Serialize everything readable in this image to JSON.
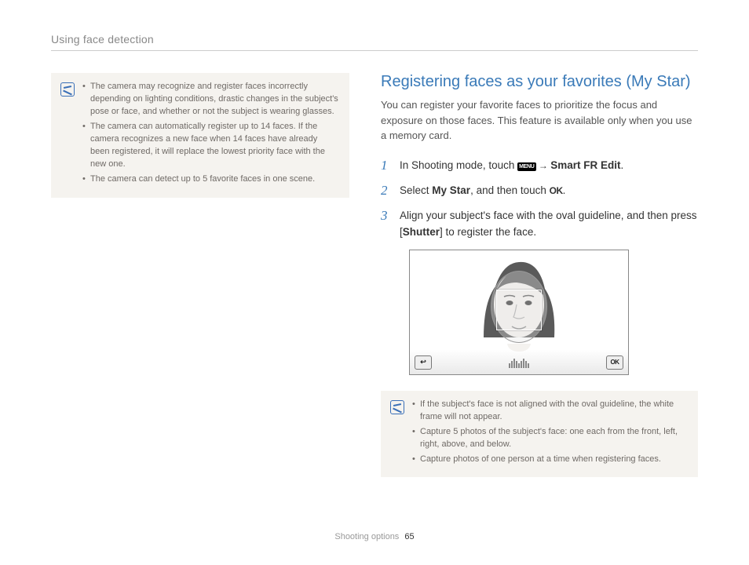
{
  "header": {
    "breadcrumb": "Using face detection"
  },
  "left_note": {
    "items": [
      "The camera may recognize and register faces incorrectly depending on lighting conditions, drastic changes in the subject's pose or face, and whether or not the subject is wearing glasses.",
      "The camera can automatically register up to 14 faces. If the camera recognizes a new face when 14 faces have already been registered, it will replace the lowest priority face with the new one.",
      "The camera can detect up to 5 favorite faces in one scene."
    ]
  },
  "section": {
    "title": "Registering faces as your favorites (My Star)",
    "intro": "You can register your favorite faces to prioritize the focus and exposure on those faces. This feature is available only when you use a memory card."
  },
  "steps": {
    "s1_pre": "In Shooting mode, touch ",
    "menu_label": "MENU",
    "s1_arrow": " → ",
    "s1_bold": "Smart FR Edit",
    "s1_end": ".",
    "s2_pre": "Select ",
    "s2_bold": "My Star",
    "s2_mid": ", and then touch ",
    "ok_label": "OK",
    "s2_end": ".",
    "s3_pre": "Align your subject's face with the oval guideline, and then press [",
    "s3_bold": "Shutter",
    "s3_end": "] to register the face."
  },
  "figure": {
    "back": "↩",
    "ok": "OK"
  },
  "right_note": {
    "items": [
      "If the subject's face is not aligned with the oval guideline, the white frame will not appear.",
      "Capture 5 photos of the subject's face: one each from the front, left, right, above, and below.",
      "Capture photos of one person at a time when registering faces."
    ]
  },
  "footer": {
    "section": "Shooting options",
    "page": "65"
  },
  "nums": {
    "n1": "1",
    "n2": "2",
    "n3": "3"
  }
}
